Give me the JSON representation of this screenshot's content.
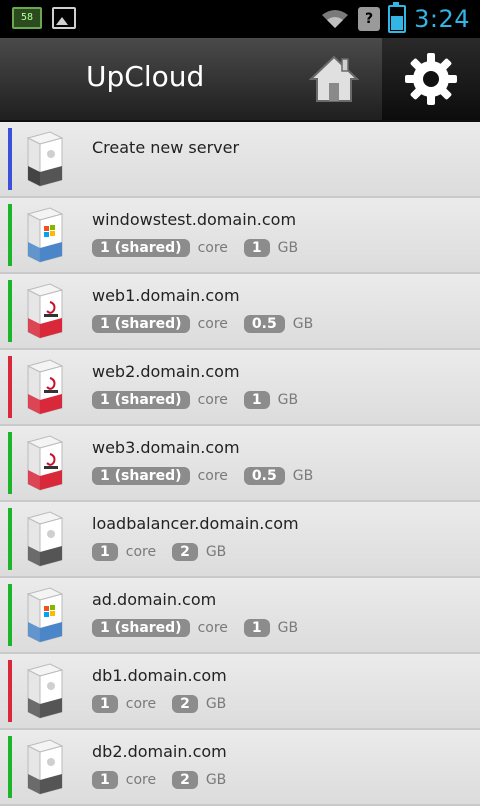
{
  "statusbar": {
    "battery_mini": "58",
    "time": "3:24"
  },
  "app": {
    "title": "UpCloud"
  },
  "list": {
    "create": {
      "label": "Create new server",
      "accent": "#3b50d9",
      "icon": "custom-server-box-icon"
    },
    "servers": [
      {
        "name": "windowstest.domain.com",
        "cores": "1 (shared)",
        "core_label": "core",
        "memory": "1",
        "memory_unit": "GB",
        "status_color": "#1cb52a",
        "icon": "windows-server-box-icon",
        "box_color": "#4a86c8"
      },
      {
        "name": "web1.domain.com",
        "cores": "1 (shared)",
        "core_label": "core",
        "memory": "0.5",
        "memory_unit": "GB",
        "status_color": "#1cb52a",
        "icon": "debian-box-icon",
        "box_color": "#d8283a"
      },
      {
        "name": "web2.domain.com",
        "cores": "1 (shared)",
        "core_label": "core",
        "memory": "1",
        "memory_unit": "GB",
        "status_color": "#d8283a",
        "icon": "debian-box-icon",
        "box_color": "#d8283a"
      },
      {
        "name": "web3.domain.com",
        "cores": "1 (shared)",
        "core_label": "core",
        "memory": "0.5",
        "memory_unit": "GB",
        "status_color": "#1cb52a",
        "icon": "debian-box-icon",
        "box_color": "#d8283a"
      },
      {
        "name": "loadbalancer.domain.com",
        "cores": "1",
        "core_label": "core",
        "memory": "2",
        "memory_unit": "GB",
        "status_color": "#1cb52a",
        "icon": "custom-server-box-icon",
        "box_color": "#555555"
      },
      {
        "name": "ad.domain.com",
        "cores": "1 (shared)",
        "core_label": "core",
        "memory": "1",
        "memory_unit": "GB",
        "status_color": "#1cb52a",
        "icon": "windows-server-box-icon",
        "box_color": "#4a86c8"
      },
      {
        "name": "db1.domain.com",
        "cores": "1",
        "core_label": "core",
        "memory": "2",
        "memory_unit": "GB",
        "status_color": "#d8283a",
        "icon": "custom-server-box-icon",
        "box_color": "#555555"
      },
      {
        "name": "db2.domain.com",
        "cores": "1",
        "core_label": "core",
        "memory": "2",
        "memory_unit": "GB",
        "status_color": "#1cb52a",
        "icon": "custom-server-box-icon",
        "box_color": "#555555"
      }
    ]
  }
}
